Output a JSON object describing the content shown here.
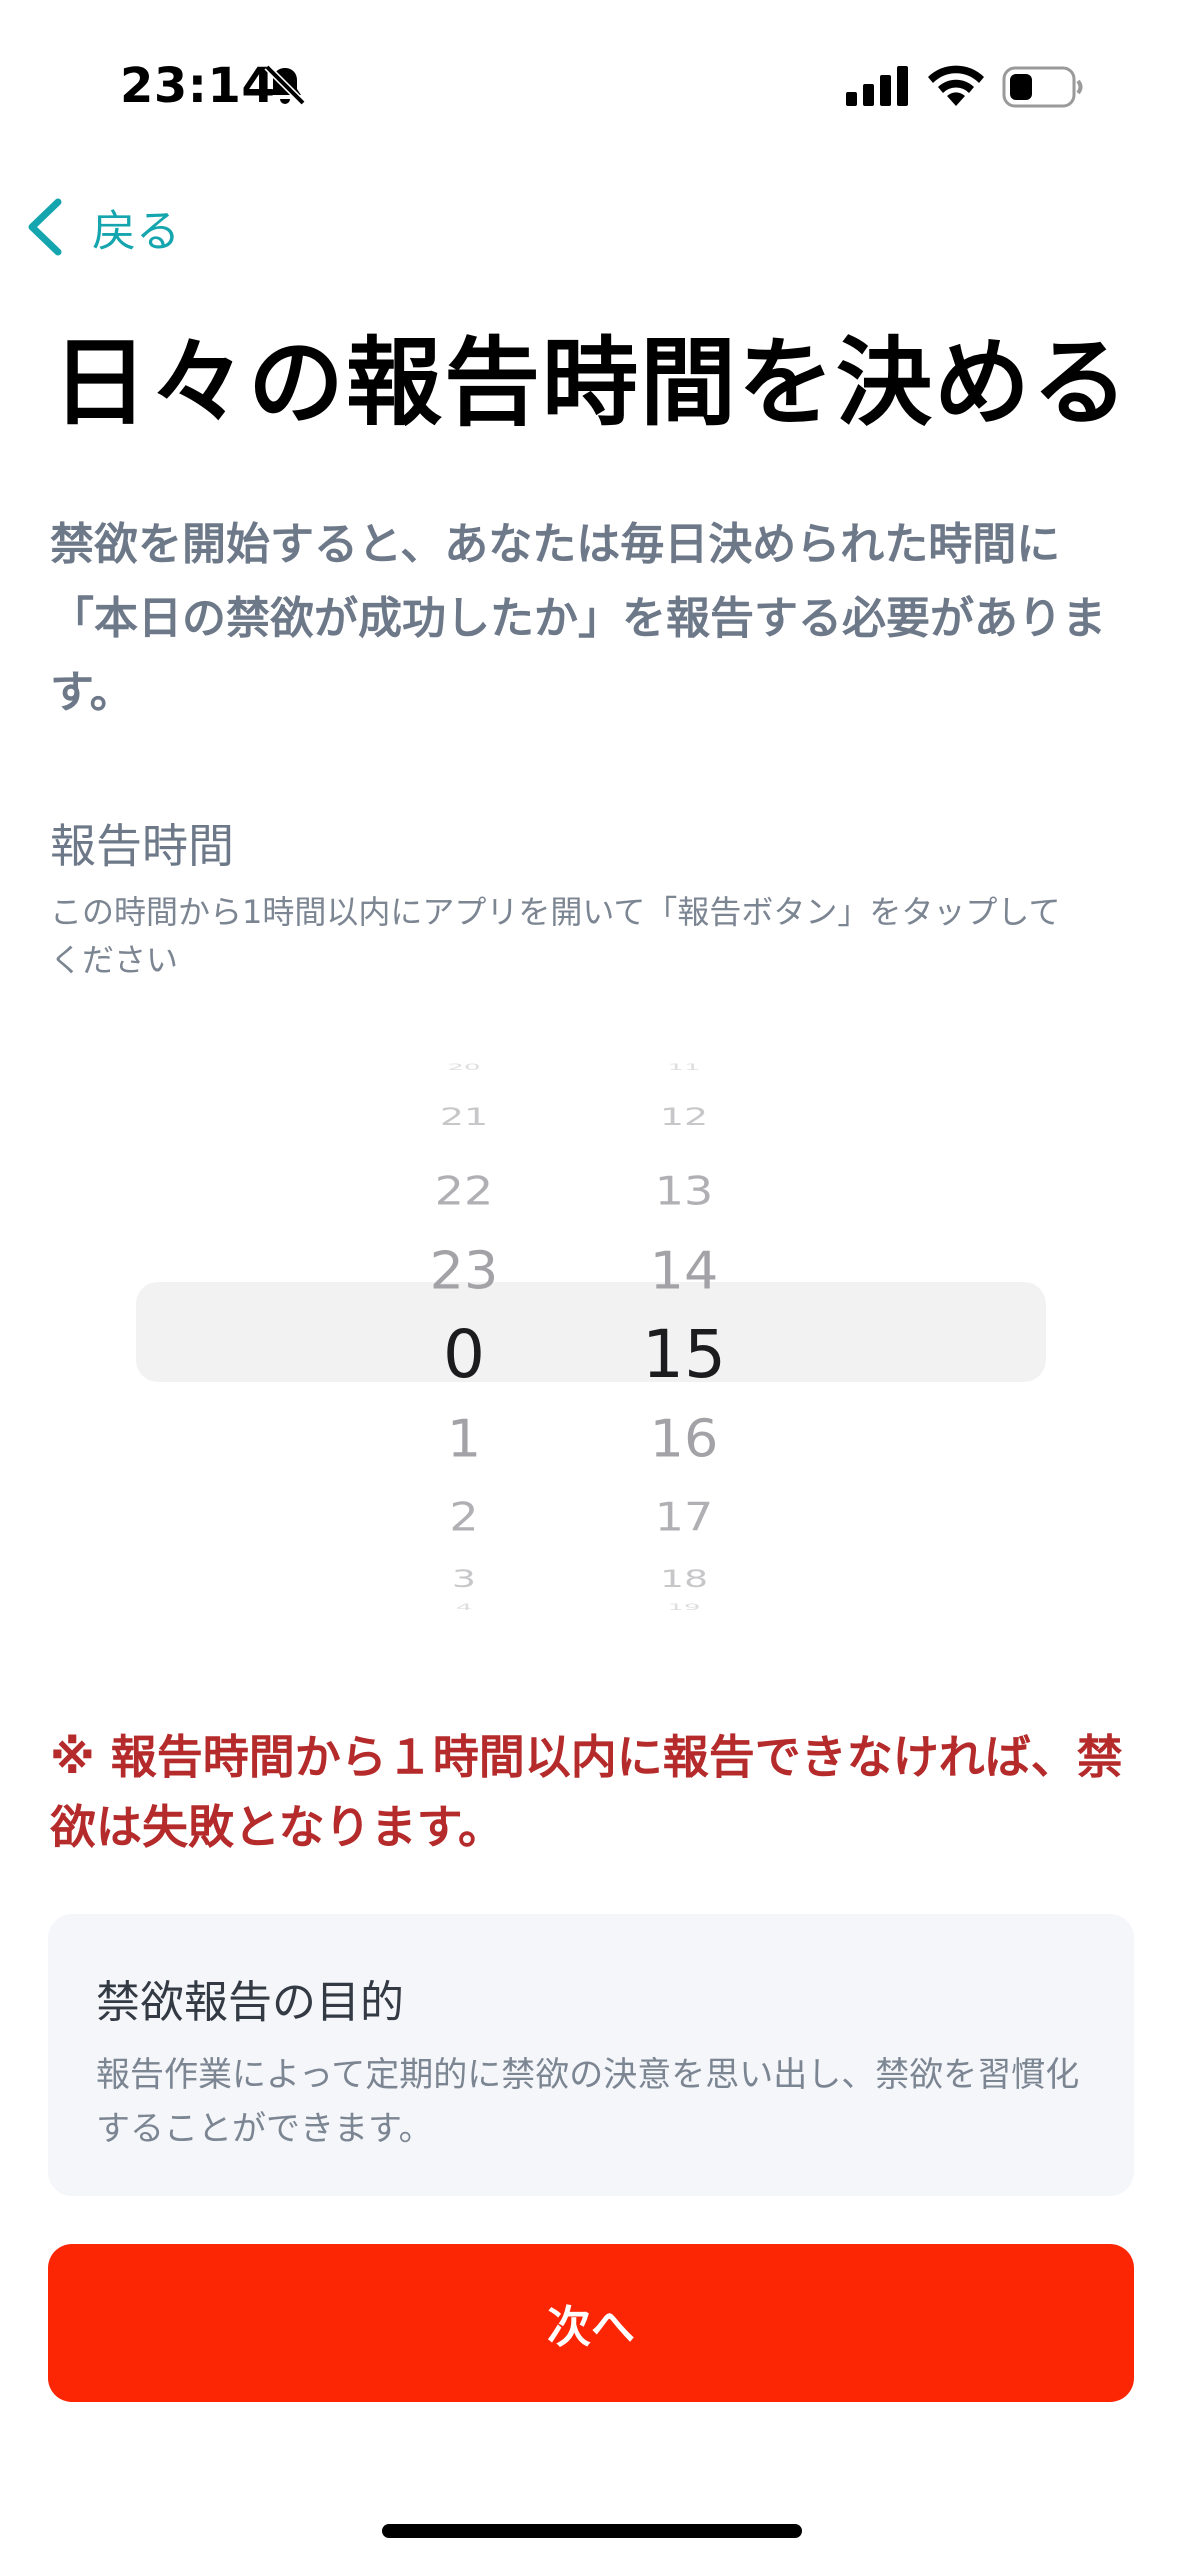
{
  "status_bar": {
    "time": "23:14"
  },
  "nav": {
    "back_label": "戻る"
  },
  "title": "日々の報告時間を決める",
  "intro": "禁欲を開始すると、あなたは毎日決められた時間に「本日の禁欲が成功したか」を報告する必要があります。",
  "report_time": {
    "heading": "報告時間",
    "subtext": "この時間から1時間以内にアプリを開いて「報告ボタン」をタップしてください"
  },
  "picker": {
    "hours": [
      "20",
      "21",
      "22",
      "23",
      "0",
      "1",
      "2",
      "3",
      "4"
    ],
    "minutes": [
      "11",
      "12",
      "13",
      "14",
      "15",
      "16",
      "17",
      "18",
      "19"
    ],
    "selected_hour": "0",
    "selected_minute": "15"
  },
  "warning": "※ 報告時間から１時間以内に報告できなければ、禁欲は失敗となります。",
  "purpose_card": {
    "title": "禁欲報告の目的",
    "body": "報告作業によって定期的に禁欲の決意を思い出し、禁欲を習慣化することができます。"
  },
  "next_button": {
    "label": "次へ"
  },
  "colors": {
    "accent_teal": "#15a5ae",
    "primary_button": "#fc2604",
    "warning_red": "#b52a2a",
    "muted_text": "#6d7888"
  }
}
